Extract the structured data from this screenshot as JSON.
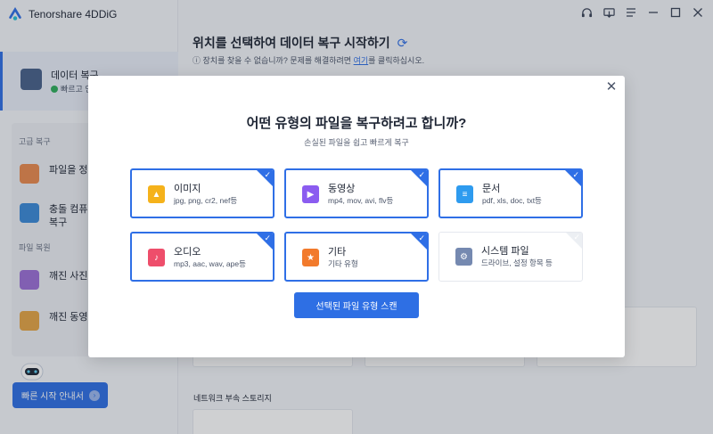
{
  "app": {
    "name": "Tenorshare 4DDiG"
  },
  "sidebar": {
    "active": {
      "label": "데이터 복구",
      "status": "빠르고 안"
    },
    "advanced_label": "고급 복구",
    "advanced_items": [
      {
        "label": "파일을 정확"
      },
      {
        "label": "충돌 컴퓨터\n복구"
      }
    ],
    "repair_label": "파일 복원",
    "repair_items": [
      {
        "label": "깨진 사진"
      },
      {
        "label": "깨진 동영상"
      }
    ],
    "quick_start": "빠른 시작 안내서"
  },
  "main": {
    "title": "위치를 선택하여 데이터 복구 시작하기",
    "subtitle_before": "장치를 찾을 수 없습니까? 문제를 해결하려면 ",
    "subtitle_link": "여기",
    "subtitle_after": "를 클릭하십시오.",
    "network_label": "네트워크 부속 스토리지"
  },
  "modal": {
    "title": "어떤 유형의 파일을 복구하려고 합니까?",
    "subtitle": "손실된 파일을 쉽고 빠르게 복구",
    "file_types": [
      {
        "label": "이미지",
        "formats": "jpg, png, cr2, nef등",
        "icon": "image-file-icon",
        "color": "#f5b21b",
        "checked": true
      },
      {
        "label": "동영상",
        "formats": "mp4, mov, avi, flv등",
        "icon": "video-file-icon",
        "color": "#8b5cf0",
        "checked": true
      },
      {
        "label": "문서",
        "formats": "pdf, xls, doc, txt등",
        "icon": "document-file-icon",
        "color": "#2e9bef",
        "checked": true
      },
      {
        "label": "오디오",
        "formats": "mp3, aac, wav, ape등",
        "icon": "audio-file-icon",
        "color": "#ee4e6b",
        "checked": true
      },
      {
        "label": "기타",
        "formats": "기타 유형",
        "icon": "other-file-icon",
        "color": "#f27a2c",
        "checked": true
      },
      {
        "label": "시스템 파일",
        "formats": "드라이브, 설정 항목 등",
        "icon": "system-file-icon",
        "color": "#7589b0",
        "checked": false
      }
    ],
    "scan_button": "선택된 파일 유형 스캔"
  },
  "colors": {
    "accent": "#2e6fe4"
  }
}
